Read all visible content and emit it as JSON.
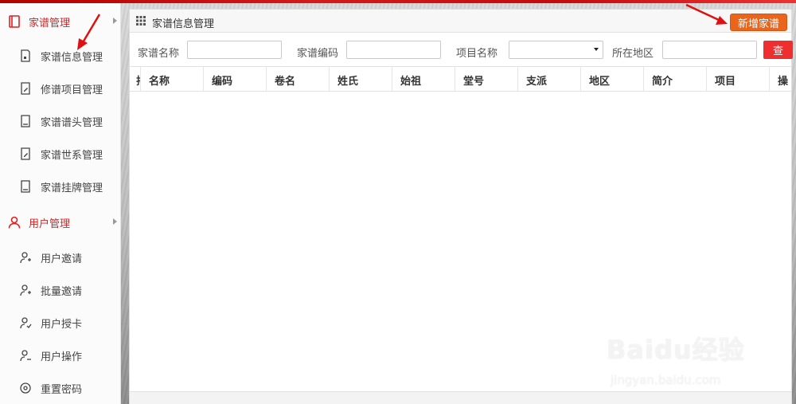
{
  "sidebar": {
    "groups": [
      {
        "label": "家谱管理",
        "items": [
          {
            "label": "家谱信息管理"
          },
          {
            "label": "修谱项目管理"
          },
          {
            "label": "家谱谱头管理"
          },
          {
            "label": "家谱世系管理"
          },
          {
            "label": "家谱挂牌管理"
          }
        ]
      },
      {
        "label": "用户管理",
        "items": [
          {
            "label": "用户邀请"
          },
          {
            "label": "批量邀请"
          },
          {
            "label": "用户授卡"
          },
          {
            "label": "用户操作"
          },
          {
            "label": "重置密码"
          }
        ]
      }
    ]
  },
  "panel": {
    "title": "家谱信息管理",
    "add_button": "新增家谱"
  },
  "filters": {
    "name_label": "家谱名称",
    "name_value": "",
    "code_label": "家谱编码",
    "code_value": "",
    "project_label": "项目名称",
    "project_value": "",
    "region_label": "所在地区",
    "region_value": "",
    "search_button": "查"
  },
  "table": {
    "columns": [
      "排",
      "名称",
      "编码",
      "卷名",
      "姓氏",
      "始祖",
      "堂号",
      "支派",
      "地区",
      "简介",
      "项目",
      "操"
    ],
    "rows": []
  },
  "watermark": {
    "logo": "Baidu经验",
    "url": "jingyan.baidu.com"
  },
  "colors": {
    "brand_red": "#e02020",
    "add_button": "#e8651b",
    "search_button": "#ef2f2f"
  }
}
